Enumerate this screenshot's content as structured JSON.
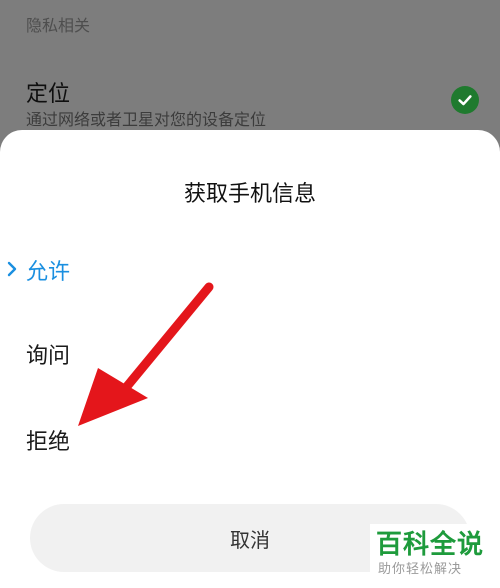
{
  "background": {
    "section_title": "隐私相关",
    "setting": {
      "title": "定位",
      "description": "通过网络或者卫星对您的设备定位",
      "enabled_icon": "check-circle-icon"
    }
  },
  "sheet": {
    "title": "获取手机信息",
    "options": [
      {
        "label": "允许",
        "selected": true
      },
      {
        "label": "询问",
        "selected": false
      },
      {
        "label": "拒绝",
        "selected": false
      }
    ],
    "cancel_label": "取消"
  },
  "overlay": {
    "annotation": "red-arrow"
  },
  "watermark": {
    "brand": "百科全说",
    "tagline": "助你轻松解决"
  },
  "colors": {
    "accent": "#1a8fe0",
    "check": "#1f7a2e",
    "arrow": "#e4161b",
    "brand": "#1e9b3c"
  }
}
